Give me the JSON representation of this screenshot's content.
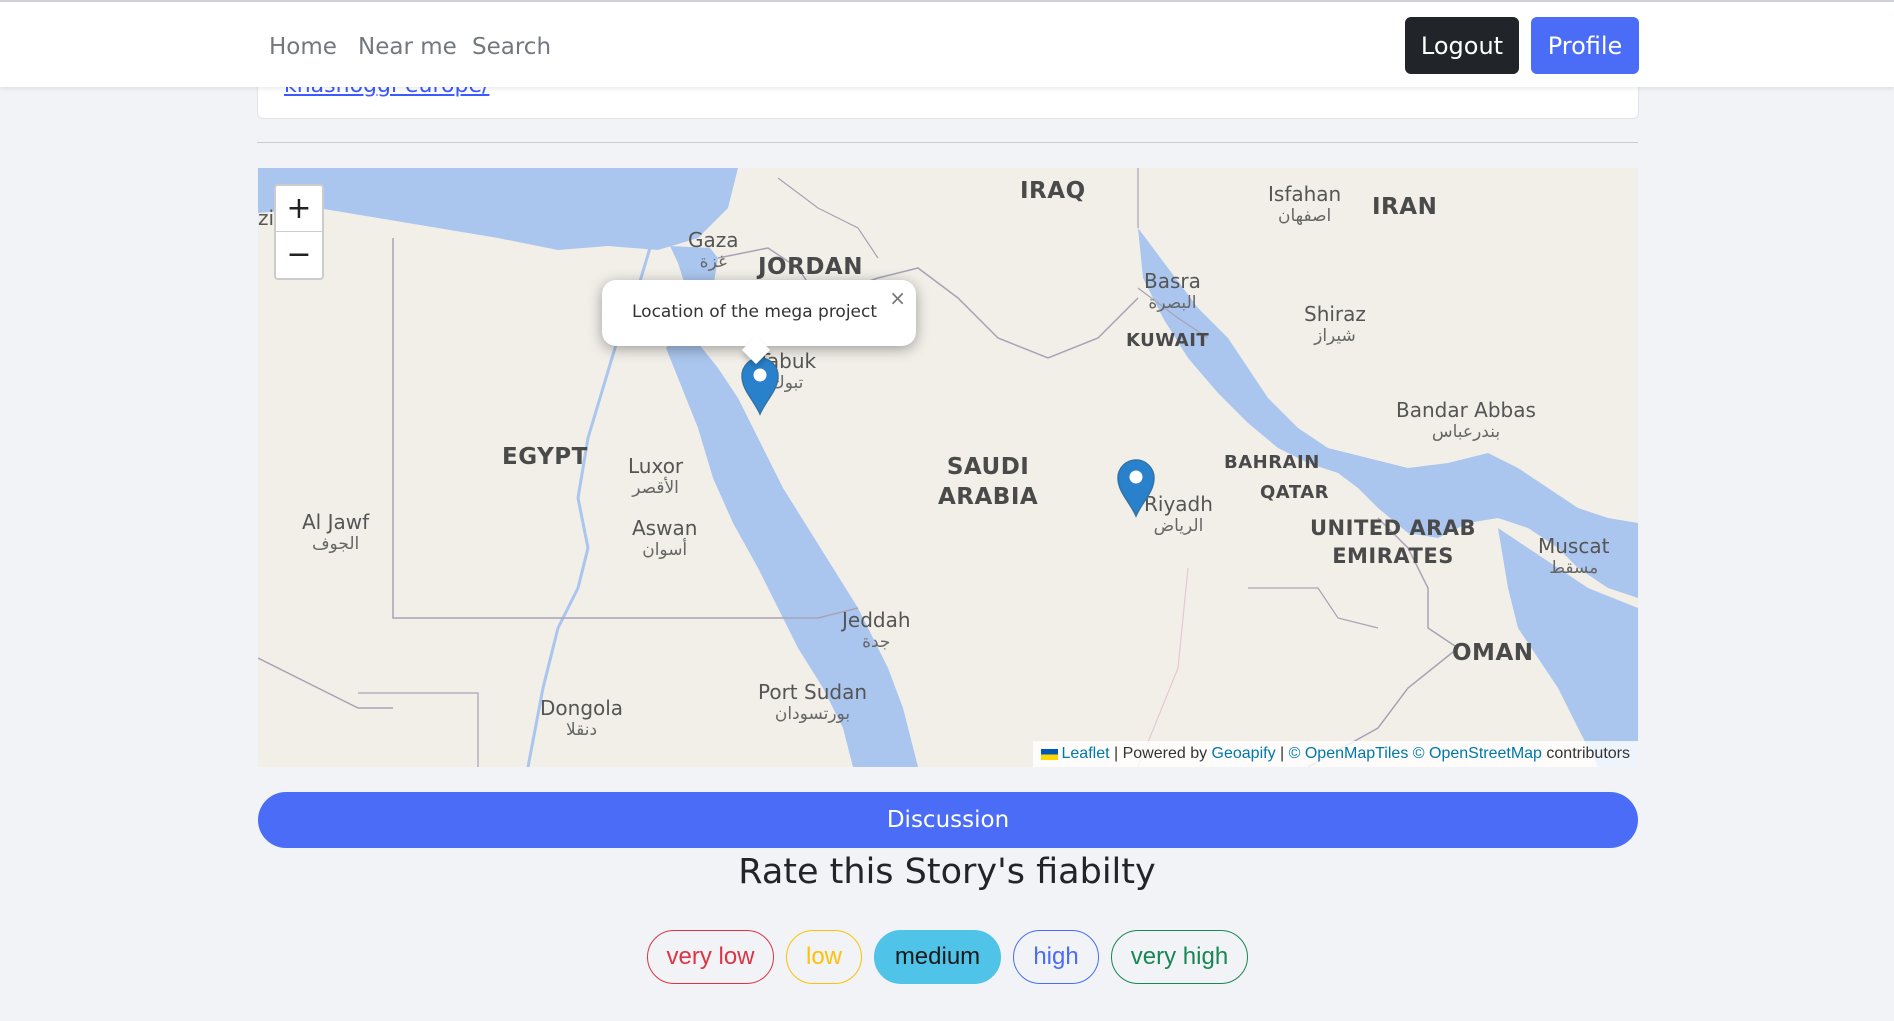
{
  "nav": {
    "links": [
      "Home",
      "Near me",
      "Search"
    ],
    "logout_label": "Logout",
    "profile_label": "Profile"
  },
  "card": {
    "link_text": "khashoggi-europe/"
  },
  "map": {
    "zoom_in": "+",
    "zoom_out": "−",
    "popup_text": "Location of the mega project",
    "popup_close": "×",
    "labels": {
      "iraq": "IRAQ",
      "iran": "IRAN",
      "isfahan": "Isfahan",
      "isfahan_ar": "اصفهان",
      "gaza": "Gaza",
      "gaza_ar": "غزة",
      "jordan": "JORDAN",
      "basra": "Basra",
      "basra_ar": "البصرة",
      "shiraz": "Shiraz",
      "shiraz_ar": "شيراز",
      "kuwait": "KUWAIT",
      "tabuk": "Tabuk",
      "tabuk_ar": "تبوك",
      "bandar_abbas": "Bandar Abbas",
      "bandar_abbas_ar": "بندرعباس",
      "egypt": "EGYPT",
      "luxor": "Luxor",
      "luxor_ar": "الأقصر",
      "saudi_arabia_1": "SAUDI",
      "saudi_arabia_2": "ARABIA",
      "bahrain": "BAHRAIN",
      "qatar": "QATAR",
      "riyadh": "Riyadh",
      "riyadh_ar": "الرياض",
      "aswan": "Aswan",
      "aswan_ar": "أسوان",
      "uae_1": "UNITED ARAB",
      "uae_2": "EMIRATES",
      "muscat": "Muscat",
      "muscat_ar": "مسقط",
      "al_jawf": "Al Jawf",
      "al_jawf_ar": "الجوف",
      "jeddah": "Jeddah",
      "jeddah_ar": "جدة",
      "oman": "OMAN",
      "port_sudan": "Port Sudan",
      "port_sudan_ar": "بورتسودان",
      "dongola": "Dongola",
      "dongola_ar": "دنقلا",
      "edge_zi": "zi"
    },
    "attribution": {
      "leaflet": "Leaflet",
      "powered_by": " | Powered by ",
      "geoapify": "Geoapify",
      "sep": " | ",
      "openmaptiles": "© OpenMapTiles",
      "osm": "© OpenStreetMap",
      "contributors": " contributors"
    },
    "colors": {
      "land": "#f2efe9",
      "water": "#aac6ee",
      "marker": "#2a81cb"
    }
  },
  "discussion_label": "Discussion",
  "rating": {
    "title": "Rate this Story's fiabilty",
    "options": [
      "very low",
      "low",
      "medium",
      "high",
      "very high"
    ],
    "selected": "medium",
    "colors": {
      "very_low": "#dc3545",
      "low": "#ffc107",
      "medium": "#4fc3e8",
      "high": "#4a6cf7",
      "very_high": "#198754"
    }
  }
}
